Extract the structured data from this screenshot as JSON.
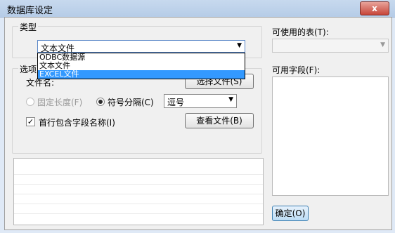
{
  "window": {
    "title": "数据库设定",
    "close_label": "x"
  },
  "type_group": {
    "label": "类型",
    "dropdown_value": "文本文件",
    "dropdown_arrow": "▼",
    "options": [
      "ODBC数据源",
      "文本文件",
      "EXCEL文件"
    ],
    "selected_option": "EXCEL文件"
  },
  "options_group": {
    "label": "选项",
    "file_name_label": "文件名:",
    "select_file_button": "选择文件(S)",
    "fixed_length_label": "固定长度(F)",
    "delimiter_label": "符号分隔(C)",
    "delimiter_value": "逗号",
    "delimiter_arrow": "▼",
    "header_checkbox_label": "首行包含字段名称(I)",
    "header_checkbox_checked": "✓",
    "view_file_button": "查看文件(B)"
  },
  "right_panel": {
    "available_tables_label": "可使用的表(T):",
    "tables_arrow": "▼",
    "available_fields_label": "可用字段(F):",
    "ok_button": "确定(O)"
  },
  "colors": {
    "dialog_bg": "#f0f0f0",
    "selection": "#3399ff"
  }
}
